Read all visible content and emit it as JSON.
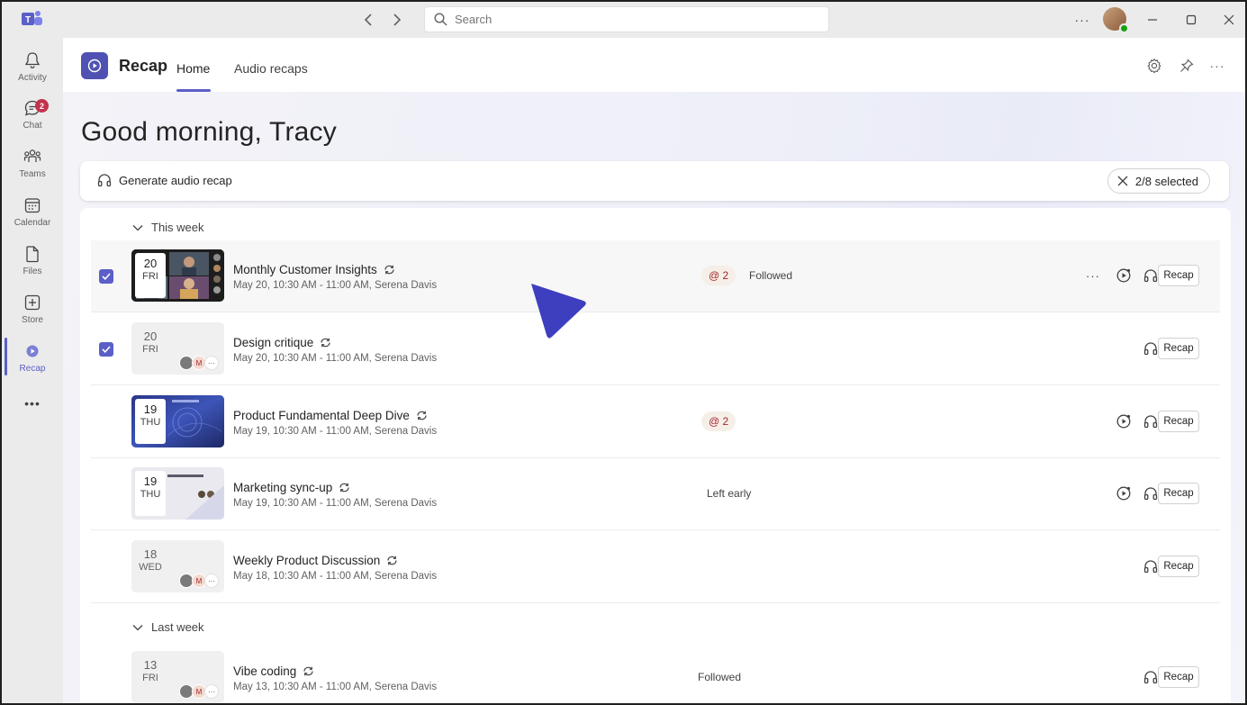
{
  "window": {
    "search_placeholder": "Search",
    "more_label": "···"
  },
  "rail": {
    "items": [
      {
        "label": "Activity",
        "icon": "bell-icon"
      },
      {
        "label": "Chat",
        "icon": "chat-icon",
        "badge": "2"
      },
      {
        "label": "Teams",
        "icon": "teams-icon"
      },
      {
        "label": "Calendar",
        "icon": "calendar-icon"
      },
      {
        "label": "Files",
        "icon": "file-icon"
      },
      {
        "label": "Store",
        "icon": "store-icon"
      },
      {
        "label": "Recap",
        "icon": "recap-icon",
        "active": true
      }
    ],
    "more": "•••"
  },
  "header": {
    "app_name": "Recap",
    "tabs": [
      {
        "label": "Home",
        "active": true
      },
      {
        "label": "Audio recaps",
        "active": false
      }
    ]
  },
  "main": {
    "greeting": "Good morning, Tracy",
    "generate_label": "Generate audio recap",
    "selected_label": "2/8 selected"
  },
  "sections": [
    {
      "label": "This week"
    },
    {
      "label": "Last week"
    }
  ],
  "meetings": [
    {
      "day": "20",
      "weekday": "FRI",
      "title": "Monthly Customer Insights",
      "subtitle": "May 20, 10:30 AM - 11:00 AM, Serena Davis",
      "mentions": "@ 2",
      "status": "Followed",
      "checked": true,
      "thumb": "video",
      "recap": "Recap"
    },
    {
      "day": "20",
      "weekday": "FRI",
      "title": "Design critique",
      "subtitle": "May 20, 10:30 AM - 11:00 AM, Serena Davis",
      "mentions": "",
      "status": "",
      "checked": true,
      "thumb": "plain",
      "recap": "Recap",
      "avatar_letter": "M"
    },
    {
      "day": "19",
      "weekday": "THU",
      "title": "Product Fundamental Deep Dive",
      "subtitle": "May 19, 10:30 AM - 11:00 AM, Serena Davis",
      "mentions": "@ 2",
      "status": "",
      "checked": false,
      "thumb": "blue",
      "recap": "Recap"
    },
    {
      "day": "19",
      "weekday": "THU",
      "title": "Marketing sync-up",
      "subtitle": "May 19, 10:30 AM - 11:00 AM, Serena Davis",
      "mentions": "",
      "status": "Left early",
      "checked": false,
      "thumb": "slide",
      "recap": "Recap"
    },
    {
      "day": "18",
      "weekday": "WED",
      "title": "Weekly Product Discussion",
      "subtitle": "May 18, 10:30 AM - 11:00 AM, Serena Davis",
      "mentions": "",
      "status": "",
      "checked": false,
      "thumb": "plain",
      "recap": "Recap",
      "avatar_letter": "M"
    },
    {
      "day": "13",
      "weekday": "FRI",
      "title": "Vibe coding",
      "subtitle": "May 13, 10:30 AM - 11:00 AM, Serena Davis",
      "mentions": "",
      "status": "Followed",
      "checked": false,
      "thumb": "plain",
      "recap": "Recap",
      "avatar_letter": "M"
    }
  ],
  "colors": {
    "accent": "#5b5fc7",
    "app_logo": "#4f52b2",
    "cursor": "#3d3fbf"
  }
}
